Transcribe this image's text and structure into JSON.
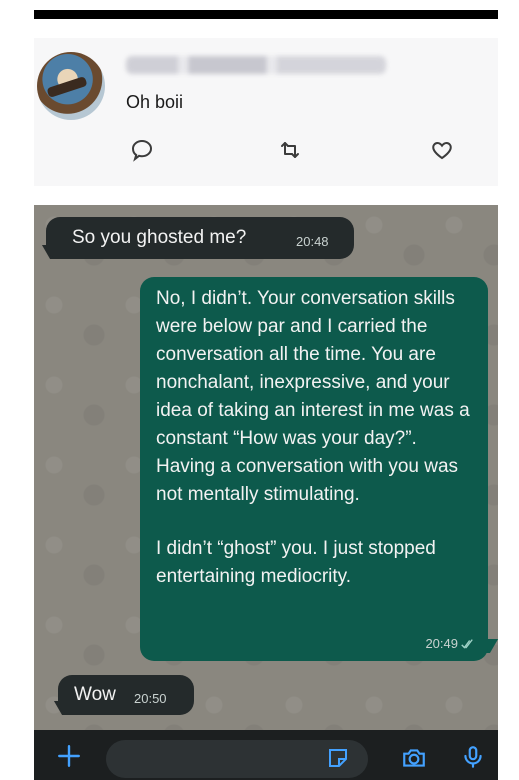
{
  "tweet": {
    "text": "Oh boii",
    "actions": [
      "comment-icon",
      "retweet-icon",
      "like-icon"
    ]
  },
  "chat": {
    "messages": [
      {
        "direction": "incoming",
        "text": "So you ghosted me?",
        "time": "20:48"
      },
      {
        "direction": "outgoing",
        "paragraph1": "No, I didn’t. Your conversation skills were below par and I carried the conversation all the time. You are nonchalant, inexpressive, and your idea of taking an interest in me was a constant “How was your day?”. Having a conversation with you was not mentally stimulating.",
        "paragraph2": "I didn’t “ghost” you. I just stopped entertaining mediocrity.",
        "time": "20:49"
      },
      {
        "direction": "incoming",
        "text": "Wow",
        "time": "20:50"
      }
    ]
  },
  "input_bar": {
    "icons": [
      "plus-icon",
      "sticker-icon",
      "camera-icon",
      "microphone-icon"
    ],
    "accent": "#43a1ff"
  },
  "colors": {
    "incoming_bubble": "#242a2b",
    "outgoing_bubble": "#0d5a4c",
    "chat_background": "#8a877f"
  }
}
